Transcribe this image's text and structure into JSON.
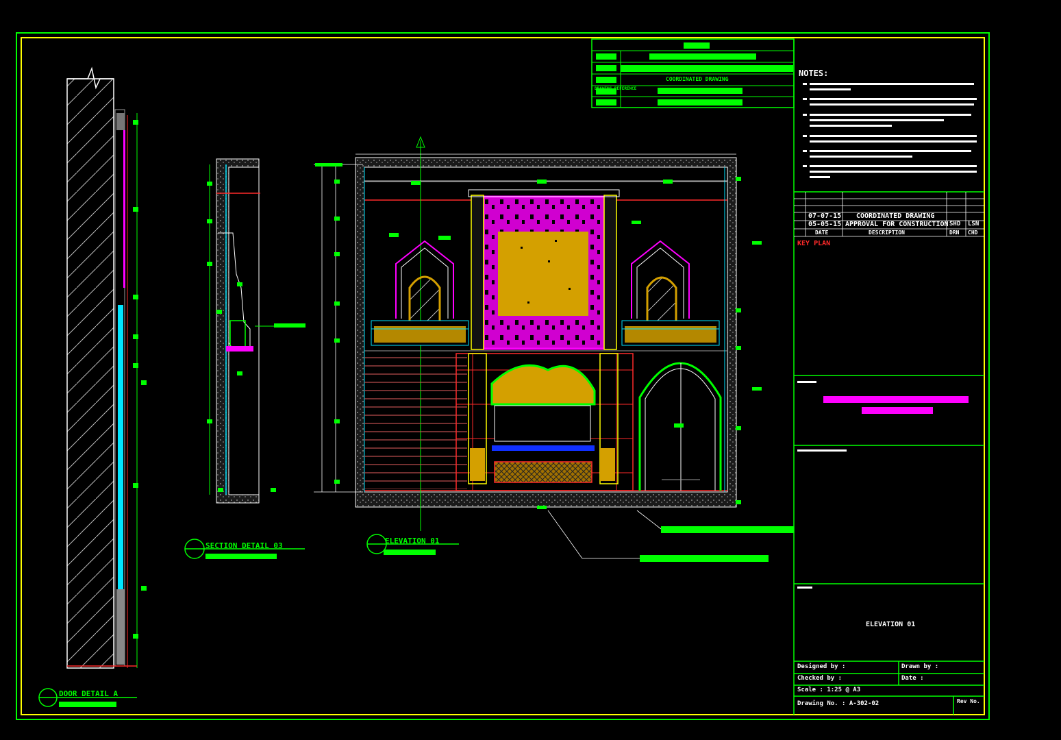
{
  "colors": {
    "background": "#000000",
    "frame": "#00ff00",
    "border": "#ffff00",
    "magenta": "#ff00ff",
    "gold": "#d4a000",
    "cyan": "#00e5ff",
    "red": "#ff2a2a",
    "white": "#ffffff",
    "grey": "#9a9a9a"
  },
  "title_block": {
    "notes_heading": "NOTES:",
    "revisions": [
      {
        "date": "07-07-15",
        "description": "COORDINATED DRAWING"
      },
      {
        "date": "05-05-15",
        "description": "APPROVAL FOR CONSTRUCTION",
        "chk": "SHD",
        "appr": "LSN"
      }
    ],
    "revision_headers": [
      "DATE",
      "DESCRIPTION",
      "DRN",
      "CHD"
    ],
    "key_plan_label": "KEY PLAN",
    "title_content": "ELEVATION 01",
    "designed_by": "Designed by : ",
    "drawn_by": "Drawn by : ",
    "checked_by": "Checked by : ",
    "date_label": "Date : ",
    "scale": "Scale : 1:25 @ A3",
    "drawing_no": "Drawing No. : A-302-02",
    "rev_label": "Rev No."
  },
  "view_labels": [
    {
      "id": "section-detail",
      "text": "SECTION DETAIL 03"
    },
    {
      "id": "elevation",
      "text": "ELEVATION 01"
    },
    {
      "id": "door-detail",
      "text": "DOOR DETAIL A"
    }
  ],
  "header_table": {
    "row_label": "DRAWING REFERENCE",
    "row_value": "COORDINATED DRAWING"
  },
  "icons": [
    "section-marker-icon",
    "north-arrow-icon",
    "break-line-icon"
  ]
}
